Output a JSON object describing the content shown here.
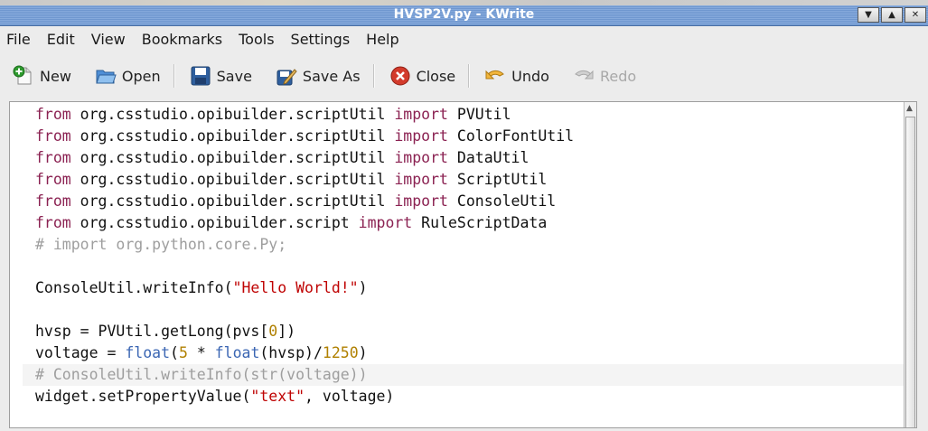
{
  "window": {
    "title": "HVSP2V.py - KWrite"
  },
  "menu": [
    "File",
    "Edit",
    "View",
    "Bookmarks",
    "Tools",
    "Settings",
    "Help"
  ],
  "toolbar": {
    "new_label": "New",
    "open_label": "Open",
    "save_label": "Save",
    "save_as_label": "Save As",
    "close_label": "Close",
    "undo_label": "Undo",
    "redo_label": "Redo"
  },
  "colors": {
    "titlebar": "#7fa3d6",
    "keyword": "#8b2252",
    "comment": "#9e9e9e",
    "string": "#bf0303",
    "builtin": "#3b66b3",
    "number": "#b08000"
  },
  "editor": {
    "lines": [
      "from org.csstudio.opibuilder.scriptUtil import PVUtil",
      "from org.csstudio.opibuilder.scriptUtil import ColorFontUtil",
      "from org.csstudio.opibuilder.scriptUtil import DataUtil",
      "from org.csstudio.opibuilder.scriptUtil import ScriptUtil",
      "from org.csstudio.opibuilder.scriptUtil import ConsoleUtil",
      "from org.csstudio.opibuilder.script import RuleScriptData",
      "# import org.python.core.Py;",
      "",
      "ConsoleUtil.writeInfo(\"Hello World!\")",
      "",
      "hvsp = PVUtil.getLong(pvs[0])",
      "voltage = float(5 * float(hvsp)/1250)",
      "# ConsoleUtil.writeInfo(str(voltage))",
      "widget.setPropertyValue(\"text\", voltage)"
    ]
  }
}
